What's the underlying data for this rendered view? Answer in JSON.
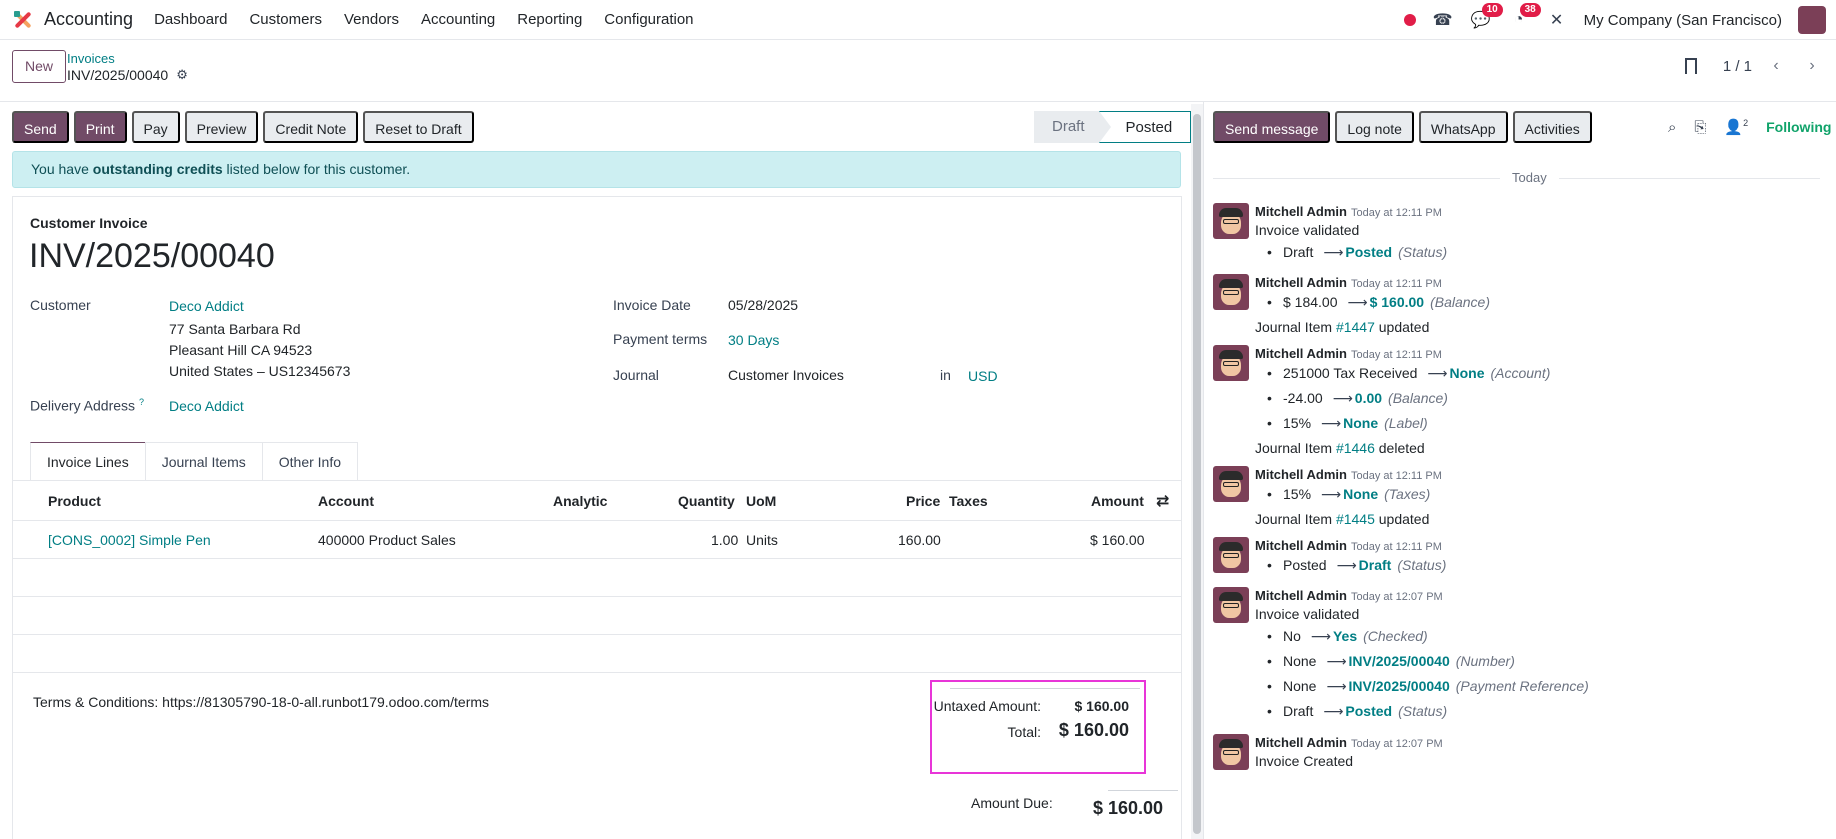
{
  "navbar": {
    "app_name": "Accounting",
    "menu": [
      "Dashboard",
      "Customers",
      "Vendors",
      "Accounting",
      "Reporting",
      "Configuration"
    ],
    "chat_badge": "10",
    "activity_badge": "38",
    "company": "My Company (San Francisco)"
  },
  "control_panel": {
    "new_label": "New",
    "breadcrumb_parent": "Invoices",
    "breadcrumb_current": "INV/2025/00040",
    "pager_value": "1 / 1"
  },
  "actions": {
    "send": "Send",
    "print": "Print",
    "pay": "Pay",
    "preview": "Preview",
    "credit_note": "Credit Note",
    "reset_to_draft": "Reset to Draft"
  },
  "status": {
    "draft": "Draft",
    "posted": "Posted"
  },
  "alert": {
    "prefix": "You have ",
    "bold": "outstanding credits",
    "suffix": " listed below for this customer."
  },
  "invoice": {
    "doc_type": "Customer Invoice",
    "number": "INV/2025/00040",
    "customer_label": "Customer",
    "customer_name": "Deco Addict",
    "address_line1": "77 Santa Barbara Rd",
    "address_line2": "Pleasant Hill CA 94523",
    "address_line3": "United States – US12345673",
    "delivery_label": "Delivery Address",
    "delivery_help": "?",
    "delivery_value": "Deco Addict",
    "invoice_date_label": "Invoice Date",
    "invoice_date": "05/28/2025",
    "payment_terms_label": "Payment terms",
    "payment_terms": "30 Days",
    "journal_label": "Journal",
    "journal": "Customer Invoices",
    "in_label": "in",
    "currency": "USD"
  },
  "tabs": [
    "Invoice Lines",
    "Journal Items",
    "Other Info"
  ],
  "lines": {
    "headers": {
      "product": "Product",
      "account": "Account",
      "analytic": "Analytic",
      "quantity": "Quantity",
      "uom": "UoM",
      "price": "Price",
      "taxes": "Taxes",
      "amount": "Amount"
    },
    "rows": [
      {
        "product": "[CONS_0002] Simple Pen",
        "account": "400000 Product Sales",
        "quantity": "1.00",
        "uom": "Units",
        "price": "160.00",
        "amount": "$ 160.00"
      }
    ]
  },
  "footer": {
    "terms": "Terms & Conditions: https://81305790-18-0-all.runbot179.odoo.com/terms",
    "untaxed_label": "Untaxed Amount:",
    "untaxed_value": "$ 160.00",
    "total_label": "Total:",
    "total_value": "$ 160.00",
    "due_label": "Amount Due:",
    "due_value": "$ 160.00"
  },
  "chatter": {
    "send_message": "Send message",
    "log_note": "Log note",
    "whatsapp": "WhatsApp",
    "activities": "Activities",
    "followers_count": "2",
    "following": "Following",
    "today": "Today",
    "messages": [
      {
        "author": "Mitchell Admin",
        "time": "Today at 12:11 PM",
        "body": "Invoice validated",
        "tracks": [
          {
            "old": "Draft",
            "new": "Posted",
            "field": "(Status)"
          }
        ]
      },
      {
        "author": "Mitchell Admin",
        "time": "Today at 12:11 PM",
        "tracks": [
          {
            "old": "$ 184.00",
            "new": "$ 160.00",
            "field": "(Balance)"
          }
        ],
        "footer_prefix": "Journal Item ",
        "footer_link": "#1447",
        "footer_suffix": " updated"
      },
      {
        "author": "Mitchell Admin",
        "time": "Today at 12:11 PM",
        "tracks": [
          {
            "old": "251000 Tax Received",
            "new": "None",
            "field": "(Account)"
          },
          {
            "old": "-24.00",
            "new": "0.00",
            "field": "(Balance)"
          },
          {
            "old": "15%",
            "new": "None",
            "field": "(Label)"
          }
        ],
        "footer_prefix": "Journal Item ",
        "footer_link": "#1446",
        "footer_suffix": " deleted"
      },
      {
        "author": "Mitchell Admin",
        "time": "Today at 12:11 PM",
        "tracks": [
          {
            "old": "15%",
            "new": "None",
            "field": "(Taxes)"
          }
        ],
        "footer_prefix": "Journal Item ",
        "footer_link": "#1445",
        "footer_suffix": " updated"
      },
      {
        "author": "Mitchell Admin",
        "time": "Today at 12:11 PM",
        "tracks": [
          {
            "old": "Posted",
            "new": "Draft",
            "field": "(Status)"
          }
        ]
      },
      {
        "author": "Mitchell Admin",
        "time": "Today at 12:07 PM",
        "body": "Invoice validated",
        "tracks": [
          {
            "old": "No",
            "new": "Yes",
            "field": "(Checked)"
          },
          {
            "old": "None",
            "new": "INV/2025/00040",
            "field": "(Number)"
          },
          {
            "old": "None",
            "new": "INV/2025/00040",
            "field": "(Payment Reference)"
          },
          {
            "old": "Draft",
            "new": "Posted",
            "field": "(Status)"
          }
        ]
      },
      {
        "author": "Mitchell Admin",
        "time": "Today at 12:07 PM",
        "body": "Invoice Created"
      }
    ]
  }
}
